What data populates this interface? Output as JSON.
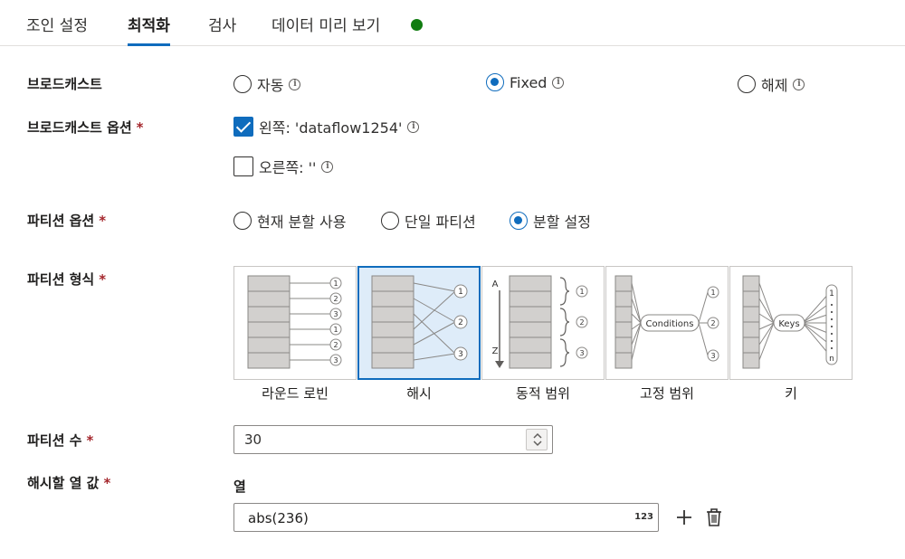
{
  "tabs": [
    {
      "label": "조인 설정"
    },
    {
      "label": "최적화"
    },
    {
      "label": "검사"
    },
    {
      "label": "데이터 미리 보기"
    }
  ],
  "broadcast": {
    "label": "브로드캐스트",
    "options": [
      {
        "label": "자동",
        "selected": false
      },
      {
        "label": "Fixed",
        "selected": true
      },
      {
        "label": "해제",
        "selected": false
      }
    ]
  },
  "broadcast_options": {
    "label": "브로드캐스트 옵션",
    "required_mark": "*",
    "left": {
      "label": "왼쪽: 'dataflow1254'",
      "checked": true
    },
    "right": {
      "label": "오른쪽: ''",
      "checked": false
    }
  },
  "partition_option": {
    "label": "파티션 옵션",
    "required_mark": "*",
    "options": [
      {
        "label": "현재 분할 사용",
        "selected": false
      },
      {
        "label": "단일 파티션",
        "selected": false
      },
      {
        "label": "분할 설정",
        "selected": true
      }
    ]
  },
  "partition_type": {
    "label": "파티션 형식",
    "required_mark": "*",
    "types": [
      {
        "label": "라운드 로빈",
        "selected": false
      },
      {
        "label": "해시",
        "selected": true
      },
      {
        "label": "동적 범위",
        "selected": false
      },
      {
        "label": "고정 범위",
        "selected": false
      },
      {
        "label": "키",
        "selected": false
      }
    ],
    "diagram_text": {
      "n1": "1",
      "n2": "2",
      "n3": "3",
      "nn": "n",
      "range_start": "A",
      "range_end": "Z",
      "conditions": "Conditions",
      "keys": "Keys"
    }
  },
  "partition_count": {
    "label": "파티션 수",
    "required_mark": "*",
    "value": "30"
  },
  "hash_columns": {
    "label": "해시할 열 값",
    "required_mark": "*",
    "column_header": "열",
    "expression": "abs(236)",
    "type_tag": "123"
  },
  "colors": {
    "accent": "#0f6cbd",
    "status_green": "#107c10",
    "required_red": "#a4262c"
  },
  "icons": [
    "info-icon",
    "check-icon",
    "chevron-up-icon",
    "chevron-down-icon",
    "plus-icon",
    "trash-icon"
  ]
}
